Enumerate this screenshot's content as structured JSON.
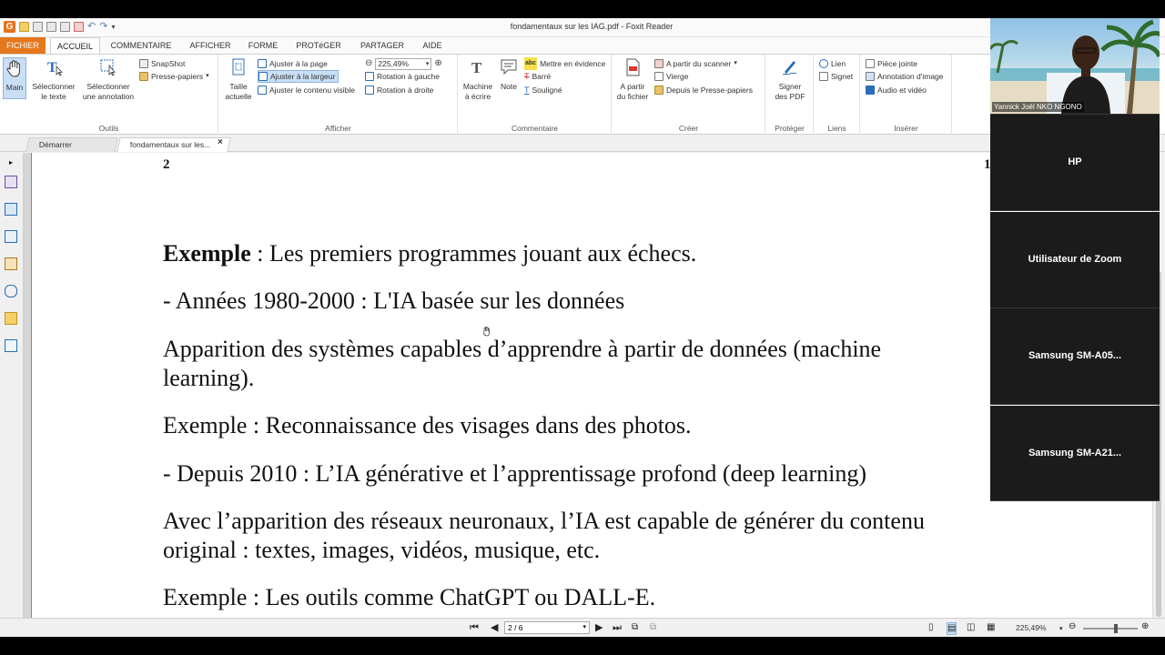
{
  "window": {
    "title": "fondamentaux sur les IAG.pdf - Foxit Reader"
  },
  "menu": [
    "FICHIER",
    "ACCUEIL",
    "COMMENTAIRE",
    "AFFICHER",
    "FORME",
    "PROTéGER",
    "PARTAGER",
    "AIDE"
  ],
  "ribbon": {
    "outils": {
      "label": "Outils",
      "main": "Main",
      "select_text": [
        "Sélectionner",
        "le texte"
      ],
      "select_annot": [
        "Sélectionner",
        "une annotation"
      ],
      "snapshot": "SnapShot",
      "clipboard": "Presse-papiers"
    },
    "afficher": {
      "label": "Afficher",
      "actual_size": [
        "Taille",
        "actuelle"
      ],
      "fit_page": "Ajuster à la page",
      "fit_width": "Ajuster à la largeur",
      "fit_visible": "Ajuster le contenu visible",
      "zoom": "225,49%",
      "rotate_left": "Rotation à gauche",
      "rotate_right": "Rotation à droite"
    },
    "commentaire": {
      "label": "Commentaire",
      "typewriter": [
        "Machine",
        "à écrire"
      ],
      "note": "Note",
      "highlight": "Mettre en évidence",
      "strikeout": "Barré",
      "underline": "Souligné"
    },
    "creer": {
      "label": "Créer",
      "from_file": [
        "A partir",
        "du fichier"
      ],
      "from_scanner": "A partir du scanner",
      "blank": "Vierge",
      "from_clipboard": "Depuis le Presse-papiers"
    },
    "proteger": {
      "label": "Protéger",
      "sign": [
        "Signer",
        "des PDF"
      ]
    },
    "liens": {
      "label": "Liens",
      "link": "Lien",
      "bookmark": "Signet"
    },
    "inserer": {
      "label": "Insérer",
      "attachment": "Pièce jointe",
      "image_annotation": "Annotation d'image",
      "audio_video": "Audio et vidéo"
    }
  },
  "doc_tabs": [
    "Démarrer",
    "fondamentaux sur les..."
  ],
  "document": {
    "page_number_left": "2",
    "page_number_right": "1",
    "lines": [
      {
        "bold": "Exemple",
        "text": " : Les premiers programmes jouant aux échecs."
      },
      {
        "text": "- Années 1980-2000 : L'IA basée sur les données"
      },
      {
        "text": "Apparition des systèmes capables d’apprendre à partir de données (machine"
      },
      {
        "text": "learning)."
      },
      {
        "text": "Exemple : Reconnaissance des visages dans des photos."
      },
      {
        "text": "- Depuis 2010 : L’IA générative et l’apprentissage profond (deep learning)"
      },
      {
        "text": "Avec l’apparition des réseaux neuronaux, l’IA est capable de générer du contenu"
      },
      {
        "text": "original : textes, images, vidéos, musique, etc."
      },
      {
        "text": "Exemple : Les outils comme ChatGPT ou DALL-E."
      }
    ]
  },
  "status": {
    "page": "2 / 6",
    "zoom": "225,49%"
  },
  "zoom_gallery": {
    "video_name": "Yannick Joël NKO NGONO",
    "participants": [
      "HP",
      "Utilisateur de Zoom",
      "Samsung  SM-A05...",
      "Samsung  SM-A21..."
    ]
  },
  "colors": {
    "accent": "#e5771d",
    "selection": "#c9dff5"
  }
}
